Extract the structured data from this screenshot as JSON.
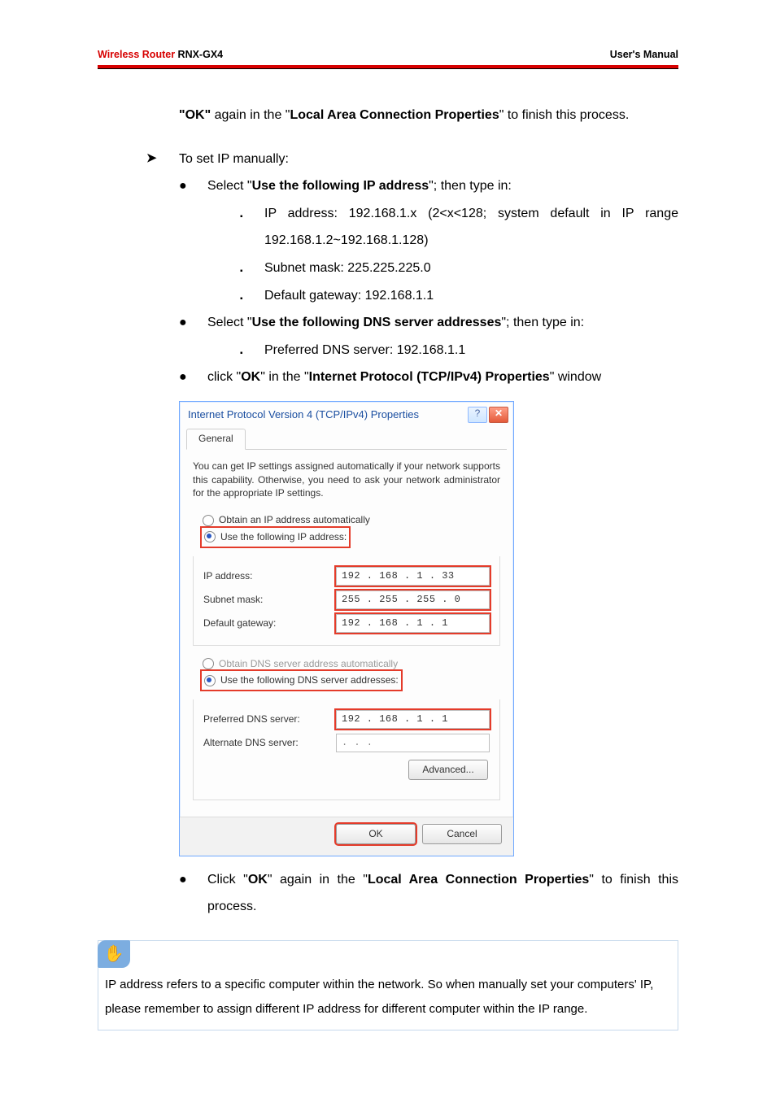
{
  "header": {
    "brand": "Wireless Router",
    "model": " RNX-GX4",
    "right": "User's Manual"
  },
  "intro": {
    "pre": "\"OK\"",
    "mid": " again in the \"",
    "bold": "Local Area Connection Properties",
    "end": "\" to finish this process."
  },
  "manual": {
    "lead": "To set IP manually:",
    "b1": {
      "pre": "Select \"",
      "bold": "Use the following IP address",
      "post": "\"; then type in:"
    },
    "s1": "IP address: 192.168.1.x (2<x<128; system default in IP range 192.168.1.2~192.168.1.128)",
    "s2": "Subnet mask: 225.225.225.0",
    "s3": "Default gateway: 192.168.1.1",
    "b2": {
      "pre": "Select \"",
      "bold": "Use the following DNS server addresses",
      "post": "\"; then type in:"
    },
    "s4": "Preferred DNS server: 192.168.1.1",
    "b3": {
      "pre": "click \"",
      "ok": "OK",
      "mid": "\" in the \"",
      "bold": "Internet Protocol (TCP/IPv4) Properties",
      "post": "\" window"
    },
    "b4": {
      "pre": "Click \"",
      "ok": "OK",
      "mid": "\" again in the \"",
      "bold": "Local Area Connection Properties",
      "post": "\" to finish this process."
    }
  },
  "dialog": {
    "title": "Internet Protocol Version 4 (TCP/IPv4) Properties",
    "tab": "General",
    "desc": "You can get IP settings assigned automatically if your network supports this capability. Otherwise, you need to ask your network administrator for the appropriate IP settings.",
    "r_auto_ip": "Obtain an IP address automatically",
    "r_use_ip": "Use the following IP address:",
    "ip_label": "IP address:",
    "ip_value": "192 . 168 .  1  . 33",
    "sm_label": "Subnet mask:",
    "sm_value": "255 . 255 . 255 .  0",
    "gw_label": "Default gateway:",
    "gw_value": "192 . 168 .  1  .  1",
    "r_auto_dns": "Obtain DNS server address automatically",
    "r_use_dns": "Use the following DNS server addresses:",
    "pdns_label": "Preferred DNS server:",
    "pdns_value": "192 . 168 .  1  .  1",
    "adns_label": "Alternate DNS server:",
    "adns_value": ".       .       .",
    "advanced": "Advanced...",
    "ok": "OK",
    "cancel": "Cancel",
    "help_glyph": "?",
    "close_glyph": "✕"
  },
  "note": {
    "icon_glyph": "✋",
    "text": "IP address refers to a specific computer within the network. So when manually set your computers' IP, please remember to assign different IP address for different computer within the IP range."
  }
}
